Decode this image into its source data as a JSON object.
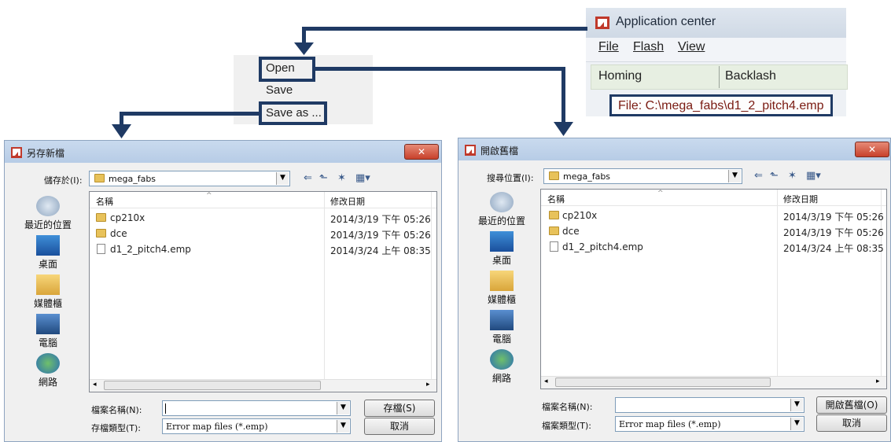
{
  "app": {
    "title": "Application center",
    "menu": [
      "File",
      "Flash",
      "View"
    ],
    "tabs": [
      "Homing",
      "Backlash"
    ],
    "file_label": "File: C:\\mega_fabs\\d1_2_pitch4.emp"
  },
  "context_menu": {
    "items": [
      "Open",
      "Save",
      "Save as ..."
    ]
  },
  "save_dialog": {
    "title": "另存新檔",
    "location_label": "儲存於(I):",
    "location_value": "mega_fabs",
    "col_name": "名稱",
    "col_date": "修改日期",
    "places": [
      "最近的位置",
      "桌面",
      "媒體櫃",
      "電腦",
      "網路"
    ],
    "files": [
      {
        "name": "cp210x",
        "date": "2014/3/19 下午 05:26",
        "type": "folder"
      },
      {
        "name": "dce",
        "date": "2014/3/19 下午 05:26",
        "type": "folder"
      },
      {
        "name": "d1_2_pitch4.emp",
        "date": "2014/3/24 上午 08:35",
        "type": "file"
      }
    ],
    "filename_label": "檔案名稱(N):",
    "filename_value": "",
    "filetype_label": "存檔類型(T):",
    "filetype_value": "Error map files (*.emp)",
    "primary_button": "存檔(S)",
    "cancel_button": "取消"
  },
  "open_dialog": {
    "title": "開啟舊檔",
    "location_label": "搜尋位置(I):",
    "location_value": "mega_fabs",
    "col_name": "名稱",
    "col_date": "修改日期",
    "places": [
      "最近的位置",
      "桌面",
      "媒體櫃",
      "電腦",
      "網路"
    ],
    "files": [
      {
        "name": "cp210x",
        "date": "2014/3/19 下午 05:26",
        "type": "folder"
      },
      {
        "name": "dce",
        "date": "2014/3/19 下午 05:26",
        "type": "folder"
      },
      {
        "name": "d1_2_pitch4.emp",
        "date": "2014/3/24 上午 08:35",
        "type": "file"
      }
    ],
    "filename_label": "檔案名稱(N):",
    "filename_value": "",
    "filetype_label": "檔案類型(T):",
    "filetype_value": "Error map files (*.emp)",
    "primary_button": "開啟舊檔(O)",
    "cancel_button": "取消"
  },
  "colors": {
    "arrow": "#1f3a64",
    "logo_red": "#c0392b"
  }
}
